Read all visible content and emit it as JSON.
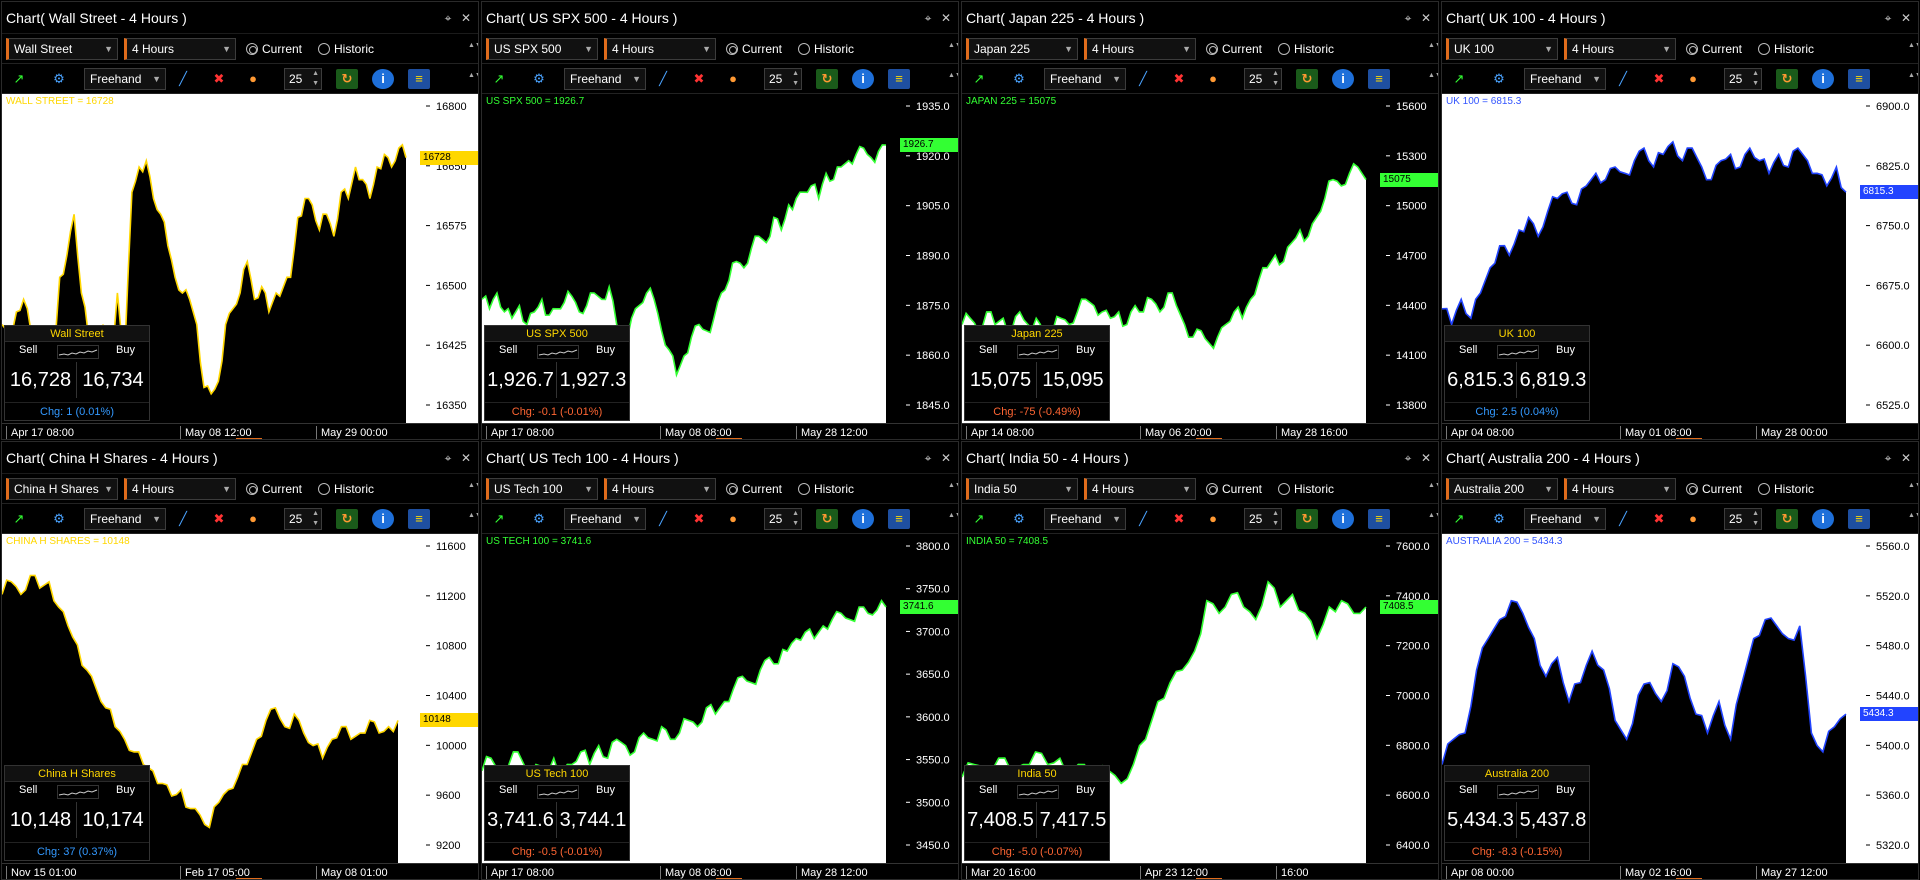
{
  "common": {
    "timeframe": "4 Hours",
    "current_label": "Current",
    "historic_label": "Historic",
    "drawing_mode": "Freehand",
    "period": "25",
    "sell_label": "Sell",
    "buy_label": "Buy",
    "pin_icon": "pin-icon",
    "close_icon": "close-icon"
  },
  "panels": [
    {
      "title": "Chart( Wall Street - 4 Hours )",
      "instrument": "Wall Street",
      "readout": "WALL STREET = 16728",
      "readout_color": "#ffd700",
      "line_color": "#ffd700",
      "fill_above": "#ffffff",
      "fill_below": "#000000",
      "axis_bg": "#ffffff",
      "tick_labels": [
        "16800",
        "16650",
        "16575",
        "16500",
        "16425",
        "16350"
      ],
      "price_tag": "16728",
      "price_tag_color": "#ffd700",
      "x_labels": [
        "Apr 17 08:00",
        "May 08 12:00",
        "May 29 00:00"
      ],
      "trade": {
        "name": "Wall Street",
        "sell": "16,728",
        "buy": "16,734",
        "chg": "Chg: 1  (0.01%)",
        "chg_color": "#3399ff"
      }
    },
    {
      "title": "Chart( US SPX 500 - 4 Hours )",
      "instrument": "US SPX 500",
      "readout": "US SPX 500 = 1926.7",
      "readout_color": "#33ff33",
      "line_color": "#33ff33",
      "fill_above": "#000000",
      "fill_below": "#ffffff",
      "axis_bg": "#000000",
      "tick_labels": [
        "1935.0",
        "1920.0",
        "1905.0",
        "1890.0",
        "1875.0",
        "1860.0",
        "1845.0"
      ],
      "price_tag": "1926.7",
      "price_tag_color": "#33ff33",
      "x_labels": [
        "Apr 17 08:00",
        "May 08 08:00",
        "May 28 12:00"
      ],
      "trade": {
        "name": "US SPX 500",
        "sell": "1,926.7",
        "buy": "1,927.3",
        "chg": "Chg: -0.1  (-0.01%)",
        "chg_color": "#ff6633"
      }
    },
    {
      "title": "Chart( Japan 225 - 4 Hours )",
      "instrument": "Japan 225",
      "readout": "JAPAN 225 = 15075",
      "readout_color": "#33ff33",
      "line_color": "#33ff33",
      "fill_above": "#000000",
      "fill_below": "#ffffff",
      "axis_bg": "#000000",
      "tick_labels": [
        "15600",
        "15300",
        "15000",
        "14700",
        "14400",
        "14100",
        "13800"
      ],
      "price_tag": "15075",
      "price_tag_color": "#33ff33",
      "x_labels": [
        "Apr 14 08:00",
        "May 06 20:00",
        "May 28 16:00"
      ],
      "trade": {
        "name": "Japan 225",
        "sell": "15,075",
        "buy": "15,095",
        "chg": "Chg: -75  (-0.49%)",
        "chg_color": "#ff6633"
      }
    },
    {
      "title": "Chart( UK 100 - 4 Hours )",
      "instrument": "UK 100",
      "readout": "UK 100 = 6815.3",
      "readout_color": "#3355ff",
      "line_color": "#2244ff",
      "fill_above": "#ffffff",
      "fill_below": "#000000",
      "axis_bg": "#ffffff",
      "tick_labels": [
        "6900.0",
        "6825.0",
        "6750.0",
        "6675.0",
        "6600.0",
        "6525.0"
      ],
      "price_tag": "6815.3",
      "price_tag_color": "#2244ff",
      "x_labels": [
        "Apr 04 08:00",
        "May 01 08:00",
        "May 28 00:00"
      ],
      "trade": {
        "name": "UK 100",
        "sell": "6,815.3",
        "buy": "6,819.3",
        "chg": "Chg: 2.5  (0.04%)",
        "chg_color": "#3399ff"
      }
    },
    {
      "title": "Chart( China H Shares - 4 Hours )",
      "instrument": "China H Shares",
      "readout": "CHINA H SHARES = 10148",
      "readout_color": "#ffd700",
      "line_color": "#ffd700",
      "fill_above": "#ffffff",
      "fill_below": "#000000",
      "axis_bg": "#ffffff",
      "tick_labels": [
        "11600",
        "11200",
        "10800",
        "10400",
        "10000",
        "9600",
        "9200"
      ],
      "price_tag": "10148",
      "price_tag_color": "#ffd700",
      "x_labels": [
        "Nov 15 01:00",
        "Feb 17 05:00",
        "May 08 01:00"
      ],
      "trade": {
        "name": "China H Shares",
        "sell": "10,148",
        "buy": "10,174",
        "chg": "Chg: 37  (0.37%)",
        "chg_color": "#3399ff"
      }
    },
    {
      "title": "Chart( US Tech 100 - 4 Hours )",
      "instrument": "US Tech 100",
      "readout": "US TECH 100 = 3741.6",
      "readout_color": "#33ff33",
      "line_color": "#33ff33",
      "fill_above": "#000000",
      "fill_below": "#ffffff",
      "axis_bg": "#000000",
      "tick_labels": [
        "3800.0",
        "3750.0",
        "3700.0",
        "3650.0",
        "3600.0",
        "3550.0",
        "3500.0",
        "3450.0"
      ],
      "price_tag": "3741.6",
      "price_tag_color": "#33ff33",
      "x_labels": [
        "Apr 17 08:00",
        "May 08 08:00",
        "May 28 12:00"
      ],
      "trade": {
        "name": "US Tech 100",
        "sell": "3,741.6",
        "buy": "3,744.1",
        "chg": "Chg: -0.5  (-0.01%)",
        "chg_color": "#ff6633"
      }
    },
    {
      "title": "Chart( India 50 - 4 Hours )",
      "instrument": "India 50",
      "readout": "INDIA 50 = 7408.5",
      "readout_color": "#33ff33",
      "line_color": "#33ff33",
      "fill_above": "#000000",
      "fill_below": "#ffffff",
      "axis_bg": "#000000",
      "tick_labels": [
        "7600.0",
        "7400.0",
        "7200.0",
        "7000.0",
        "6800.0",
        "6600.0",
        "6400.0"
      ],
      "price_tag": "7408.5",
      "price_tag_color": "#33ff33",
      "x_labels": [
        "Mar 20 16:00",
        "Apr 23 12:00",
        "16:00"
      ],
      "trade": {
        "name": "India 50",
        "sell": "7,408.5",
        "buy": "7,417.5",
        "chg": "Chg: -5.0  (-0.07%)",
        "chg_color": "#ff6633"
      }
    },
    {
      "title": "Chart( Australia 200 - 4 Hours )",
      "instrument": "Australia 200",
      "readout": "AUSTRALIA 200 = 5434.3",
      "readout_color": "#3355ff",
      "line_color": "#2244ff",
      "fill_above": "#ffffff",
      "fill_below": "#000000",
      "axis_bg": "#ffffff",
      "tick_labels": [
        "5560.0",
        "5520.0",
        "5480.0",
        "5440.0",
        "5400.0",
        "5360.0",
        "5320.0"
      ],
      "price_tag": "5434.3",
      "price_tag_color": "#2244ff",
      "x_labels": [
        "Apr 08 00:00",
        "May 02 16:00",
        "May 27 12:00"
      ],
      "trade": {
        "name": "Australia 200",
        "sell": "5,434.3",
        "buy": "5,437.8",
        "chg": "Chg: -8.3  (-0.15%)",
        "chg_color": "#ff6633"
      }
    }
  ]
}
